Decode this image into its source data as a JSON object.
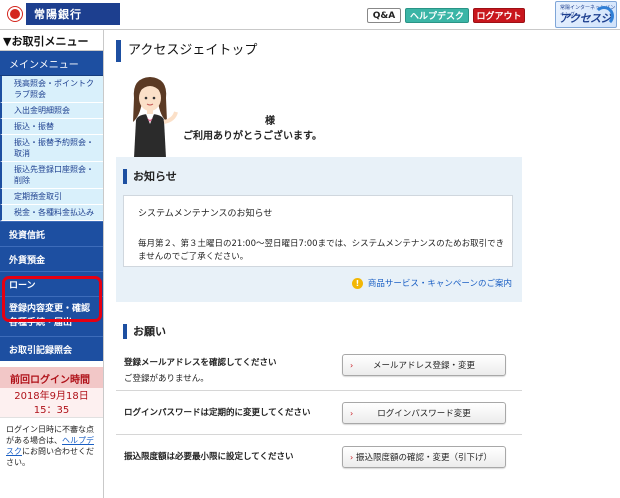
{
  "header": {
    "bank_name": "常陽銀行",
    "qa_label": "Q&A",
    "help_label": "ヘルプデスク",
    "logout_label": "ログアウト",
    "brand_small": "常陽インターネットバンキング",
    "brand_big": "アクセスジョイ",
    "colors": {
      "bank_blue": "#1d3f8f",
      "help_teal": "#3bb5a6",
      "logout_red": "#c8161d"
    }
  },
  "sidebar": {
    "menu_title": "▼お取引メニュー",
    "main_menu_label": "メインメニュー",
    "sub_items": [
      "残高照会・ポイントクラブ照会",
      "入出金明細照会",
      "振込・振替",
      "振込・振替予約照会・取消",
      "振込先登録口座照会・削除",
      "定期預金取引",
      "税金・各種料金払込み"
    ],
    "nav_items": [
      "投資信託",
      "外貨預金",
      "ローン"
    ],
    "highlight_item_line1": "登録内容変更・確認",
    "highlight_item_line2": "各種手続・届出",
    "history_item": "お取引記録照会",
    "last_login_label": "前回ログイン時間",
    "last_login_date": "2018年9月18日",
    "last_login_time": "15：35",
    "help_text_1": "ログイン日時に不審な点がある場合は、",
    "help_link": "ヘルプデスク",
    "help_text_2": "にお問い合わせください。"
  },
  "main": {
    "page_title": "アクセスジェイトップ",
    "greeting_sama": "様",
    "greeting_thanks": "ご利用ありがとうございます。",
    "news": {
      "heading": "お知らせ",
      "item_title": "システムメンテナンスのお知らせ",
      "item_body": "毎月第２、第３土曜日の21:00～翌日曜日7:00までは、システムメンテナンスのためお取引できませんのでご了承ください。",
      "campaign_link": "商品サービス・キャンペーンのご案内"
    },
    "requests": {
      "heading": "お願い",
      "rows": [
        {
          "label": "登録メールアドレスを確認してください",
          "sub": "ご登録がありません。",
          "button": "メールアドレス登録・変更"
        },
        {
          "label": "ログインパスワードは定期的に変更してください",
          "sub": "",
          "button": "ログインパスワード変更"
        },
        {
          "label": "振込限度額は必要最小限に設定してください",
          "sub": "",
          "button": "振込限度額の確認・変更（引下げ）"
        }
      ]
    }
  }
}
